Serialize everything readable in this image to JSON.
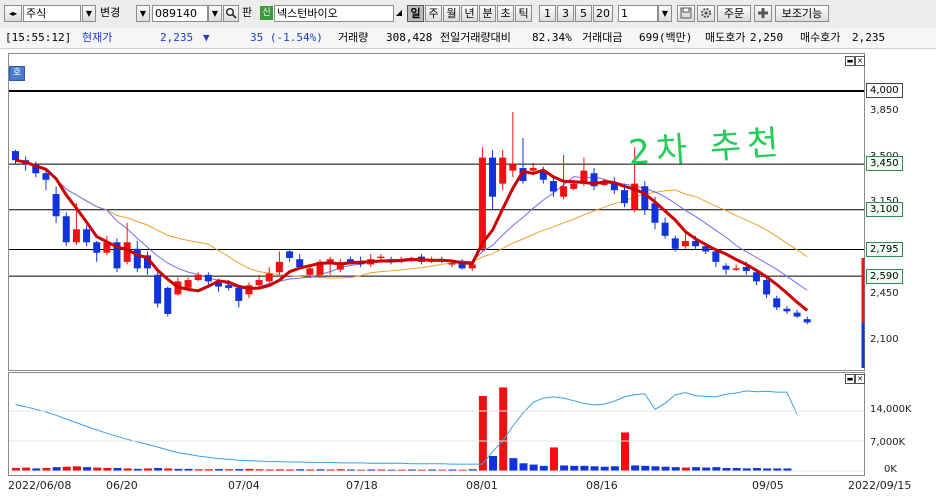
{
  "toolbar": {
    "market_type": "주식",
    "change_label": "변경",
    "stock_code": "089140",
    "pan_label": "판",
    "stock_badge": "신",
    "stock_name": "넥스턴바이오",
    "periods": [
      "일",
      "주",
      "월",
      "년",
      "분",
      "초",
      "틱"
    ],
    "active_period": "일",
    "nums": [
      "1",
      "3",
      "5",
      "20"
    ],
    "count_value": "1",
    "order_label": "주문",
    "aux_label": "보조기능",
    "icons": {
      "nav": "left-right-arrow-icon",
      "search": "search-icon",
      "dropdown": "chevron-down-icon",
      "save": "save-icon",
      "settings": "gear-icon",
      "add": "plus-icon"
    }
  },
  "status": {
    "time": "[15:55:12]",
    "price_label": "현재가",
    "price": "2,235",
    "change_arrow": "▼",
    "change": "35 (-1.54%)",
    "volume_label": "거래량",
    "volume": "308,428",
    "prev_ratio_label": "전일거래량대비",
    "prev_ratio": "82.34%",
    "amount_label": "거래대금",
    "amount": "699(백만)",
    "ask_label": "매도호가",
    "ask": "2,250",
    "bid_label": "매수호가",
    "bid": "2,235"
  },
  "chart": {
    "ho_label": "호",
    "annotation": "2차 추천",
    "price_ticks": [
      "3,850",
      "3,500",
      "3,150",
      "2,450",
      "2,100"
    ],
    "levels": [
      "4,000",
      "3,450",
      "3,100",
      "2,795",
      "2,590"
    ],
    "volume_ticks": [
      "14,000K",
      "7,000K",
      "0K"
    ],
    "x_labels": [
      "2022/06/08",
      "06/20",
      "07/04",
      "07/18",
      "08/01",
      "08/16",
      "09/05",
      "2022/09/15"
    ],
    "colors": {
      "up": "#ee1111",
      "down": "#1133dd",
      "ma5": "#cc0000",
      "ma10": "#6f6ff0",
      "ma20": "#f0a030",
      "level": "#000000",
      "annotation": "#22cc55"
    }
  },
  "candles": [
    [
      3550,
      3480,
      3560,
      3450
    ],
    [
      3480,
      3450,
      3510,
      3400
    ],
    [
      3450,
      3380,
      3470,
      3350
    ],
    [
      3380,
      3330,
      3400,
      3250
    ],
    [
      3220,
      3050,
      3280,
      3000
    ],
    [
      3050,
      2850,
      3080,
      2820
    ],
    [
      2850,
      2950,
      3150,
      2830
    ],
    [
      2950,
      2850,
      2980,
      2820
    ],
    [
      2850,
      2770,
      2860,
      2700
    ],
    [
      2770,
      2850,
      2900,
      2750
    ],
    [
      2850,
      2650,
      2880,
      2620
    ],
    [
      2700,
      2850,
      3000,
      2680
    ],
    [
      2800,
      2650,
      2860,
      2620
    ],
    [
      2750,
      2650,
      2780,
      2600
    ],
    [
      2600,
      2380,
      2620,
      2350
    ],
    [
      2500,
      2300,
      2510,
      2280
    ],
    [
      2450,
      2550,
      2580,
      2440
    ],
    [
      2500,
      2560,
      2580,
      2480
    ],
    [
      2560,
      2600,
      2620,
      2550
    ],
    [
      2600,
      2550,
      2620,
      2500
    ],
    [
      2540,
      2510,
      2570,
      2470
    ],
    [
      2520,
      2500,
      2560,
      2480
    ],
    [
      2500,
      2400,
      2520,
      2350
    ],
    [
      2450,
      2520,
      2540,
      2420
    ],
    [
      2520,
      2560,
      2600,
      2500
    ],
    [
      2550,
      2610,
      2660,
      2540
    ],
    [
      2620,
      2700,
      2780,
      2600
    ],
    [
      2780,
      2730,
      2800,
      2700
    ],
    [
      2720,
      2660,
      2760,
      2640
    ],
    [
      2600,
      2650,
      2680,
      2580
    ],
    [
      2600,
      2700,
      2720,
      2580
    ],
    [
      2700,
      2720,
      2740,
      2600
    ],
    [
      2640,
      2690,
      2720,
      2620
    ],
    [
      2720,
      2700,
      2740,
      2680
    ],
    [
      2700,
      2680,
      2740,
      2660
    ],
    [
      2680,
      2720,
      2760,
      2660
    ],
    [
      2740,
      2740,
      2760,
      2700
    ],
    [
      2720,
      2700,
      2740,
      2680
    ],
    [
      2700,
      2720,
      2740,
      2690
    ],
    [
      2720,
      2720,
      2740,
      2700
    ],
    [
      2740,
      2700,
      2760,
      2680
    ],
    [
      2700,
      2720,
      2740,
      2690
    ],
    [
      2720,
      2700,
      2740,
      2690
    ],
    [
      2690,
      2690,
      2720,
      2660
    ],
    [
      2700,
      2650,
      2720,
      2640
    ],
    [
      2650,
      2680,
      2700,
      2630
    ],
    [
      2800,
      3500,
      3580,
      2780
    ],
    [
      3500,
      3200,
      3560,
      3100
    ],
    [
      3300,
      3500,
      3560,
      3250
    ],
    [
      3400,
      3450,
      3850,
      3350
    ],
    [
      3420,
      3320,
      3650,
      3300
    ],
    [
      3400,
      3420,
      3460,
      3380
    ],
    [
      3390,
      3330,
      3430,
      3300
    ],
    [
      3320,
      3240,
      3350,
      3200
    ],
    [
      3200,
      3280,
      3520,
      3180
    ],
    [
      3260,
      3300,
      3320,
      3250
    ],
    [
      3300,
      3400,
      3500,
      3280
    ],
    [
      3380,
      3280,
      3420,
      3250
    ],
    [
      3290,
      3310,
      3340,
      3280
    ],
    [
      3300,
      3250,
      3350,
      3220
    ],
    [
      3250,
      3150,
      3300,
      3120
    ],
    [
      3100,
      3300,
      3580,
      3080
    ],
    [
      3280,
      3100,
      3320,
      3060
    ],
    [
      3150,
      3000,
      3200,
      2950
    ],
    [
      3000,
      2900,
      3040,
      2880
    ],
    [
      2880,
      2800,
      2900,
      2780
    ],
    [
      2820,
      2860,
      2920,
      2800
    ],
    [
      2860,
      2820,
      2900,
      2800
    ],
    [
      2820,
      2780,
      2840,
      2760
    ],
    [
      2780,
      2700,
      2800,
      2660
    ],
    [
      2670,
      2640,
      2690,
      2600
    ],
    [
      2650,
      2650,
      2680,
      2630
    ],
    [
      2660,
      2630,
      2700,
      2600
    ],
    [
      2620,
      2550,
      2640,
      2520
    ],
    [
      2560,
      2450,
      2580,
      2420
    ],
    [
      2420,
      2350,
      2440,
      2330
    ],
    [
      2340,
      2320,
      2360,
      2300
    ],
    [
      2310,
      2280,
      2330,
      2270
    ],
    [
      2260,
      2235,
      2280,
      2220
    ]
  ],
  "volume_bars": [
    [
      700,
      1
    ],
    [
      800,
      1
    ],
    [
      600,
      0
    ],
    [
      700,
      1
    ],
    [
      900,
      0
    ],
    [
      1000,
      1
    ],
    [
      1100,
      1
    ],
    [
      900,
      0
    ],
    [
      800,
      1
    ],
    [
      700,
      1
    ],
    [
      700,
      0
    ],
    [
      600,
      1
    ],
    [
      500,
      0
    ],
    [
      600,
      1
    ],
    [
      700,
      0
    ],
    [
      600,
      1
    ],
    [
      500,
      0
    ],
    [
      500,
      0
    ],
    [
      400,
      1
    ],
    [
      400,
      1
    ],
    [
      450,
      0
    ],
    [
      400,
      1
    ],
    [
      450,
      0
    ],
    [
      500,
      1
    ],
    [
      400,
      1
    ],
    [
      350,
      1
    ],
    [
      400,
      1
    ],
    [
      350,
      1
    ],
    [
      400,
      0
    ],
    [
      350,
      1
    ],
    [
      400,
      0
    ],
    [
      350,
      1
    ],
    [
      400,
      1
    ],
    [
      350,
      0
    ],
    [
      300,
      1
    ],
    [
      350,
      0
    ],
    [
      350,
      1
    ],
    [
      300,
      0
    ],
    [
      300,
      1
    ],
    [
      350,
      0
    ],
    [
      300,
      1
    ],
    [
      350,
      0
    ],
    [
      300,
      1
    ],
    [
      350,
      0
    ],
    [
      300,
      1
    ],
    [
      400,
      0
    ],
    [
      17500,
      1
    ],
    [
      3500,
      0
    ],
    [
      19500,
      1
    ],
    [
      3000,
      0
    ],
    [
      1800,
      0
    ],
    [
      1500,
      0
    ],
    [
      1200,
      0
    ],
    [
      5500,
      1
    ],
    [
      1300,
      0
    ],
    [
      1200,
      0
    ],
    [
      1200,
      0
    ],
    [
      1100,
      0
    ],
    [
      1000,
      0
    ],
    [
      1100,
      0
    ],
    [
      9000,
      1
    ],
    [
      1300,
      0
    ],
    [
      1200,
      0
    ],
    [
      1100,
      0
    ],
    [
      1000,
      0
    ],
    [
      900,
      0
    ],
    [
      800,
      1
    ],
    [
      900,
      0
    ],
    [
      800,
      0
    ],
    [
      900,
      0
    ],
    [
      700,
      0
    ],
    [
      700,
      0
    ],
    [
      600,
      0
    ],
    [
      700,
      0
    ],
    [
      600,
      0
    ],
    [
      600,
      0
    ],
    [
      600,
      0
    ]
  ],
  "obv_line": [
    15500,
    15000,
    14400,
    13800,
    13000,
    12100,
    11300,
    10400,
    9600,
    8800,
    8100,
    7400,
    6800,
    6200,
    5600,
    4900,
    4300,
    3900,
    3500,
    3200,
    2900,
    2700,
    2500,
    2400,
    2300,
    2200,
    2200,
    2100,
    2100,
    2000,
    2000,
    2000,
    1900,
    1900,
    1900,
    1800,
    1800,
    1800,
    1800,
    1700,
    1700,
    1700,
    1700,
    1600,
    1600,
    1600,
    1600,
    4500,
    7000,
    10500,
    13500,
    16000,
    17000,
    17300,
    17000,
    16400,
    15800,
    15400,
    15600,
    16300,
    17300,
    17800,
    18000,
    14400,
    15800,
    17800,
    18300,
    17600,
    17400,
    17300,
    17900,
    18200,
    18700,
    18500,
    18600,
    18400,
    18400,
    13200
  ]
}
